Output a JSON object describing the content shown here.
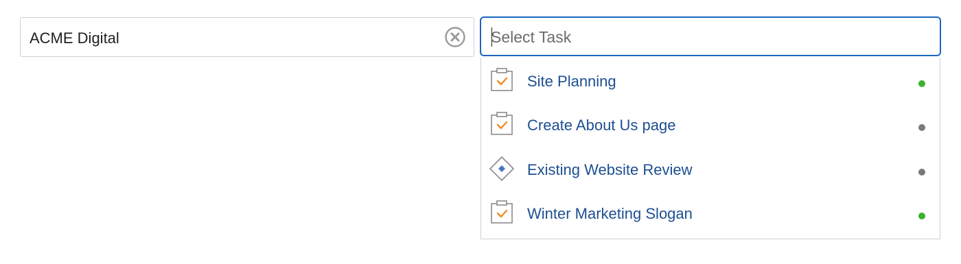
{
  "client_field": {
    "value": "ACME Digital",
    "clear_icon": "clear-circle-icon"
  },
  "task_field": {
    "placeholder": "Select Task",
    "value": ""
  },
  "options": [
    {
      "label": "Site Planning",
      "icon": "task-clipboard-icon",
      "status": "active",
      "status_color": "#3cb22e"
    },
    {
      "label": "Create About Us page",
      "icon": "task-clipboard-icon",
      "status": "inactive",
      "status_color": "#7a7a7a"
    },
    {
      "label": "Existing Website Review",
      "icon": "milestone-diamond-icon",
      "status": "inactive",
      "status_color": "#7a7a7a"
    },
    {
      "label": "Winter Marketing Slogan",
      "icon": "task-clipboard-icon",
      "status": "active",
      "status_color": "#3cb22e"
    }
  ],
  "colors": {
    "focus_border": "#1a66c2",
    "option_text": "#1d4f91",
    "check_orange": "#f08a24",
    "diamond_blue": "#4a78c2"
  }
}
